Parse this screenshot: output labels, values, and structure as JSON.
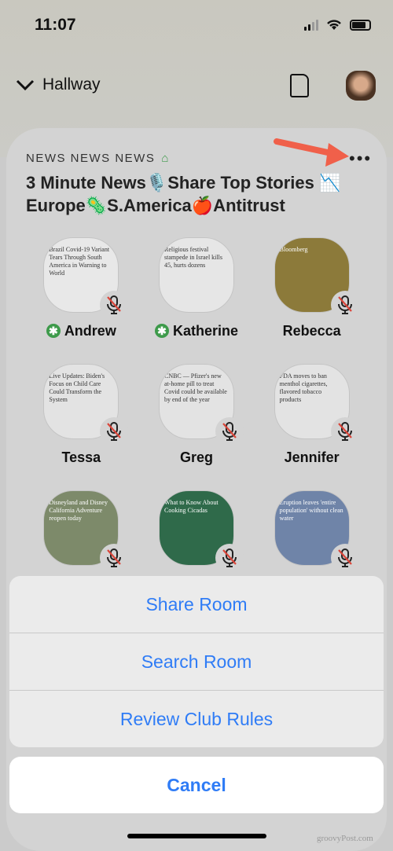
{
  "status": {
    "time": "11:07"
  },
  "header": {
    "room_back": "Hallway"
  },
  "room": {
    "club": "NEWS NEWS NEWS",
    "title": "3 Minute News🎙️Share Top Stories 📉Europe🦠S.America🍎Antitrust",
    "speakers": [
      {
        "name": "Andrew",
        "moderator": true,
        "muted": true,
        "thumb": "Brazil Covid-19 Variant Tears Through South America in Warning to World",
        "bg": "#e8e8e8"
      },
      {
        "name": "Katherine",
        "moderator": true,
        "muted": false,
        "thumb": "Religious festival stampede in Israel kills 45, hurts dozens",
        "bg": "#e6e6e6"
      },
      {
        "name": "Rebecca",
        "moderator": false,
        "muted": true,
        "thumb": "Bloomberg",
        "bg": "#8c7a3a"
      },
      {
        "name": "Tessa",
        "moderator": false,
        "muted": true,
        "thumb": "Live Updates: Biden's Focus on Child Care Could Transform the System",
        "bg": "#e3e3e3"
      },
      {
        "name": "Greg",
        "moderator": false,
        "muted": true,
        "thumb": "CNBC — Pfizer's new at-home pill to treat Covid could be available by end of the year",
        "bg": "#e3e3e3"
      },
      {
        "name": "Jennifer",
        "moderator": false,
        "muted": true,
        "thumb": "FDA moves to ban menthol cigarettes, flavored tobacco products",
        "bg": "#e3e3e3"
      },
      {
        "name": "",
        "moderator": false,
        "muted": true,
        "thumb": "Disneyland and Disney California Adventure reopen today",
        "bg": "#7d8a6a"
      },
      {
        "name": "",
        "moderator": false,
        "muted": true,
        "thumb": "What to Know About Cooking Cicadas",
        "bg": "#2f6a4a"
      },
      {
        "name": "",
        "moderator": false,
        "muted": true,
        "thumb": "Eruption leaves 'entire population' without clean water",
        "bg": "#6f84a8"
      }
    ]
  },
  "action_sheet": {
    "options": [
      "Share Room",
      "Search Room",
      "Review Club Rules"
    ],
    "cancel": "Cancel"
  },
  "watermark": "groovyPost.com",
  "colors": {
    "accent": "#2f7cf6",
    "annotation_arrow": "#f0604a",
    "moderator": "#3d9a4a"
  }
}
